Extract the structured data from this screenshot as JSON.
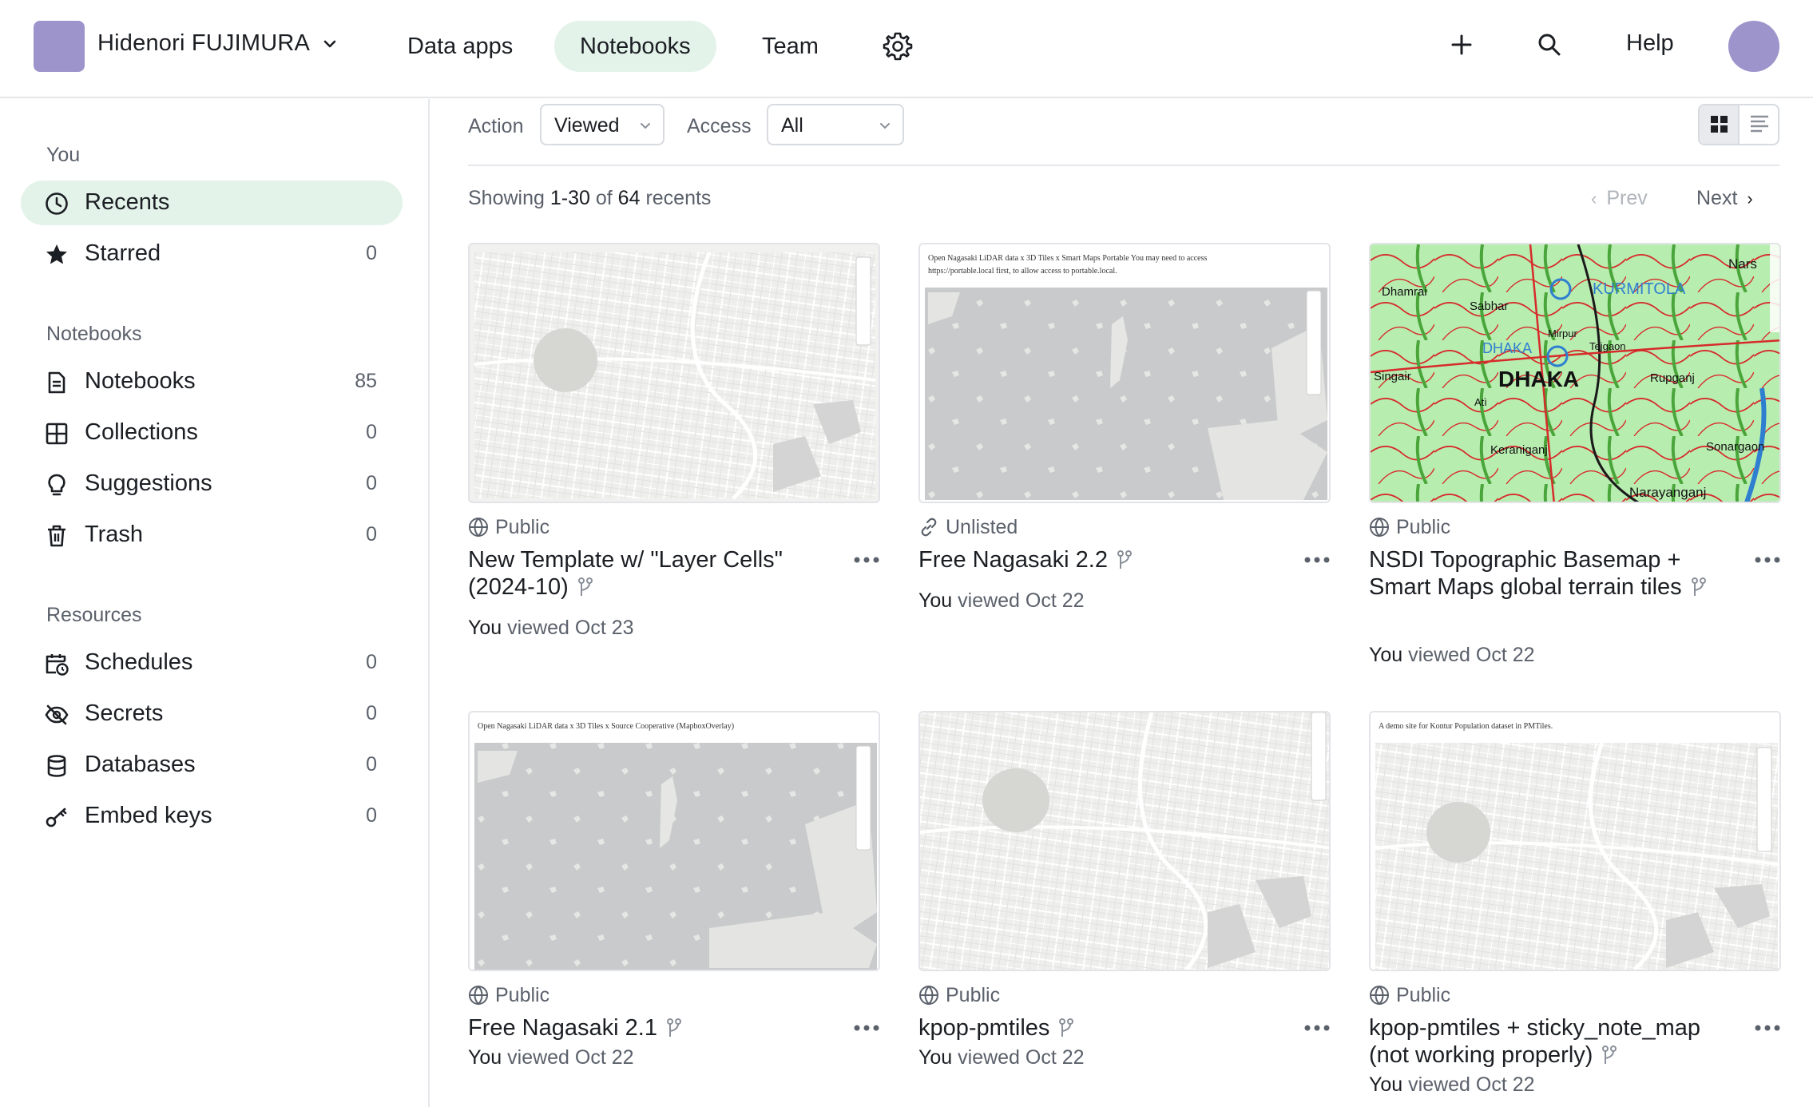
{
  "header": {
    "workspace_name": "Hidenori FUJIMURA",
    "tabs": [
      {
        "label": "Data apps",
        "active": false
      },
      {
        "label": "Notebooks",
        "active": true
      },
      {
        "label": "Team",
        "active": false
      }
    ],
    "help_label": "Help"
  },
  "sidebar": {
    "section_you": "You",
    "section_notebooks": "Notebooks",
    "section_resources": "Resources",
    "items": [
      {
        "label": "Recents",
        "count": "",
        "icon": "clock-icon"
      },
      {
        "label": "Starred",
        "count": "0",
        "icon": "star-icon"
      },
      {
        "label": "Notebooks",
        "count": "85",
        "icon": "document-icon"
      },
      {
        "label": "Collections",
        "count": "0",
        "icon": "grid-icon"
      },
      {
        "label": "Suggestions",
        "count": "0",
        "icon": "lightbulb-icon"
      },
      {
        "label": "Trash",
        "count": "0",
        "icon": "trash-icon"
      },
      {
        "label": "Schedules",
        "count": "0",
        "icon": "calendar-clock-icon"
      },
      {
        "label": "Secrets",
        "count": "0",
        "icon": "eye-off-icon"
      },
      {
        "label": "Databases",
        "count": "0",
        "icon": "database-icon"
      },
      {
        "label": "Embed keys",
        "count": "0",
        "icon": "key-icon"
      }
    ]
  },
  "filters": {
    "action_label": "Action",
    "action_value": "Viewed",
    "access_label": "Access",
    "access_value": "All"
  },
  "listing": {
    "showing_prefix": "Showing",
    "range": "1-30",
    "of_word": "of",
    "total": "64",
    "suffix": "recents",
    "prev_label": "Prev",
    "next_label": "Next"
  },
  "cards": [
    {
      "visibility": "Public",
      "title": "New Template w/ \"Layer Cells\" (2024-10)",
      "you": "You",
      "meta": "viewed Oct 23",
      "thumb_caption": ""
    },
    {
      "visibility": "Unlisted",
      "title": "Free Nagasaki 2.2",
      "you": "You",
      "meta": "viewed Oct 22",
      "thumb_caption": "Open Nagasaki LiDAR data x 3D Tiles x Smart Maps Portable You may need to access https://portable.local first, to allow access to portable.local."
    },
    {
      "visibility": "Public",
      "title": "NSDI Topographic Basemap + Smart Maps global terrain tiles",
      "you": "You",
      "meta": "viewed Oct 22",
      "thumb_caption": ""
    },
    {
      "visibility": "Public",
      "title": "Free Nagasaki 2.1",
      "you": "You",
      "meta": "viewed Oct 22",
      "thumb_caption": "Open Nagasaki LiDAR data x 3D Tiles x Source Cooperative (MapboxOverlay)"
    },
    {
      "visibility": "Public",
      "title": "kpop-pmtiles",
      "you": "You",
      "meta": "viewed Oct 22",
      "thumb_caption": ""
    },
    {
      "visibility": "Public",
      "title": "kpop-pmtiles + sticky_note_map (not working properly)",
      "you": "You",
      "meta": "viewed Oct 22",
      "thumb_caption": "A demo site for Kontur Population dataset in PMTiles."
    }
  ],
  "map_labels": {
    "dhaka": "DHAKA",
    "kurmitola": "KURMITOLA",
    "dhaka_small": "DHAKA",
    "places": [
      "Dhamrai",
      "Sabhar",
      "Singair",
      "Mirpur",
      "Tejgaon",
      "Rupganj",
      "Keraniganj",
      "Narayanganj",
      "Sonargaon",
      "Atì",
      "Nars"
    ]
  },
  "colors": {
    "accent_bg": "#e4f3ea",
    "avatar": "#9d94cc",
    "muted_text": "#5b616b"
  }
}
